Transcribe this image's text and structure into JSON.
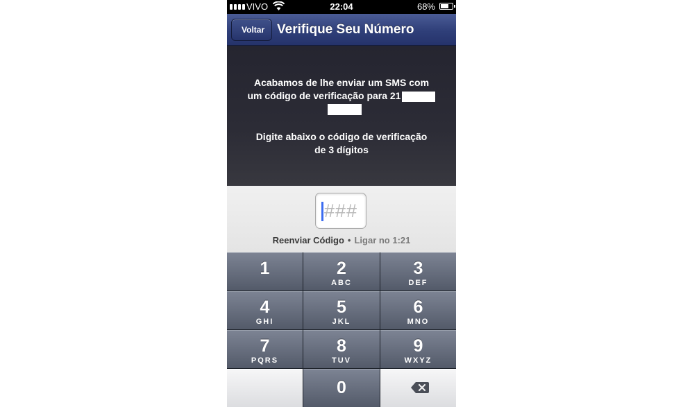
{
  "status_bar": {
    "carrier": "VIVO",
    "time": "22:04",
    "battery": "68%",
    "battery_level": 0.68
  },
  "navbar": {
    "back_label": "Voltar",
    "title": "Verifique Seu Número"
  },
  "message": {
    "line1": "Acabamos de lhe enviar um SMS com",
    "line2": "um código de verificação para 21",
    "instruction_line1": "Digite abaixo o código de verificação",
    "instruction_line2": "de 3 dígitos"
  },
  "code_input": {
    "placeholder": "###",
    "value": ""
  },
  "actions": {
    "resend_label": "Reenviar Código",
    "separator": "•",
    "call_label": "Ligar no 1:21"
  },
  "keypad": {
    "keys": [
      {
        "num": "1",
        "letters": ""
      },
      {
        "num": "2",
        "letters": "ABC"
      },
      {
        "num": "3",
        "letters": "DEF"
      },
      {
        "num": "4",
        "letters": "GHI"
      },
      {
        "num": "5",
        "letters": "JKL"
      },
      {
        "num": "6",
        "letters": "MNO"
      },
      {
        "num": "7",
        "letters": "PQRS"
      },
      {
        "num": "8",
        "letters": "TUV"
      },
      {
        "num": "9",
        "letters": "WXYZ"
      },
      {
        "num": "0",
        "letters": ""
      }
    ],
    "delete_icon": "backspace-icon"
  },
  "colors": {
    "navbar": "#2f3f79",
    "caret": "#3b6cf0",
    "key_dark": "#636a79",
    "key_light": "#e8e9eb"
  }
}
